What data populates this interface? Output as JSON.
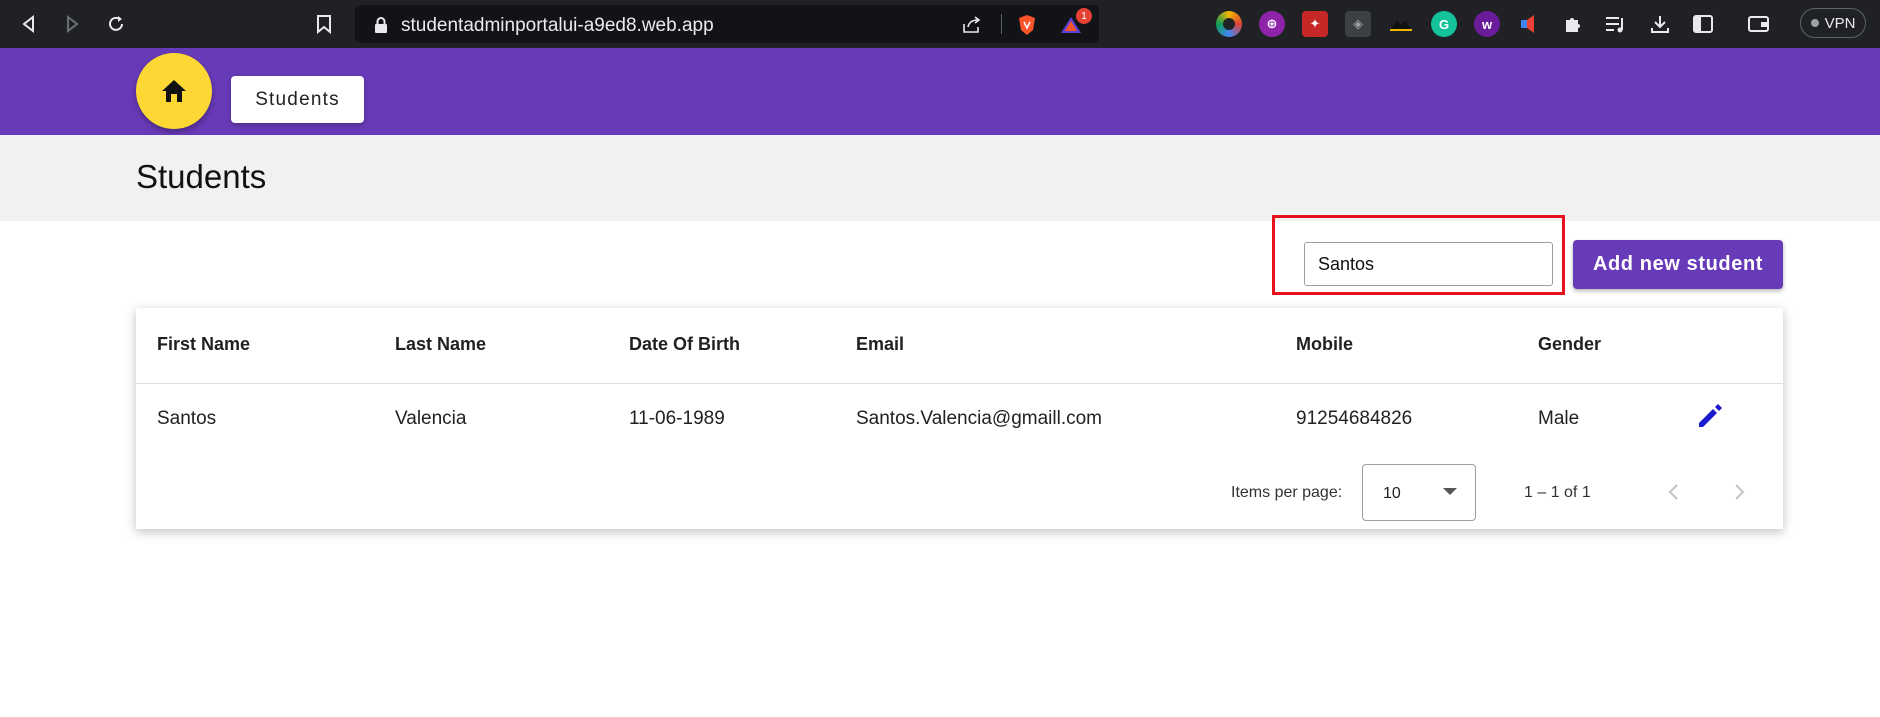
{
  "browser": {
    "url": "studentadminportalui-a9ed8.web.app",
    "vpn_label": "VPN",
    "ext_badge": "1"
  },
  "toolbar": {
    "students_label": "Students"
  },
  "page": {
    "title": "Students"
  },
  "search": {
    "value": "Santos"
  },
  "actions": {
    "add_label": "Add new student"
  },
  "table": {
    "columns": [
      "First Name",
      "Last Name",
      "Date Of Birth",
      "Email",
      "Mobile",
      "Gender"
    ],
    "rows": [
      {
        "first_name": "Santos",
        "last_name": "Valencia",
        "dob": "11-06-1989",
        "email": "Santos.Valencia@gmaill.com",
        "mobile": "91254684826",
        "gender": "Male"
      }
    ]
  },
  "paginator": {
    "items_label": "Items per page:",
    "page_size": "10",
    "range": "1 – 1 of 1"
  },
  "colors": {
    "primary": "#673ab7",
    "accent": "#fdd835",
    "edit": "#1a1acf",
    "highlight": "#e8121c"
  }
}
